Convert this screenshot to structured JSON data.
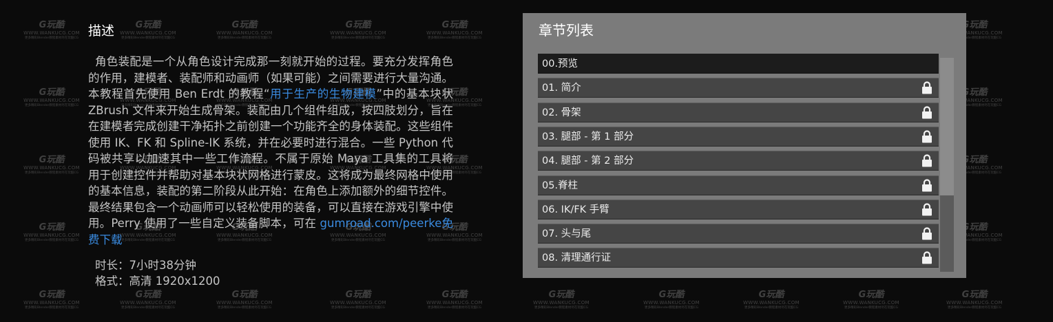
{
  "description": {
    "title": "描述",
    "body_part1": "角色装配是一个从角色设计完成那一刻就开始的过程。要充分发挥角色的作用，建模者、装配师和动画师（如果可能）之间需要进行大量沟通。本教程首先使用 Ben Erdt 的教程“",
    "body_link1": "用于生产的生物建模",
    "body_part2": "”中的基本块状 ZBrush 文件来开始生成骨架。装配由几个组件组成，按四肢划分，旨在在建模者完成创建干净拓扑之前创建一个功能齐全的身体装配。这些组件使用 IK、FK 和 Spline-IK 系统，并在必要时进行混合。一些 Python 代码被共享以加速其中一些工作流程。不属于原始 Maya 工具集的工具将用于创建控件并帮助对基本块状网格进行蒙皮。这将成为最终网格中使用的基本信息，装配的第二阶段从此开始：在角色上添加额外的细节控件。最终结果包含一个动画师可以轻松使用的装备，可以直接在游戏引擎中使用。Perry 使用了一些自定义装备脚本，可在 ",
    "body_link2": "gumroad.com/peerke免费下载",
    "duration": "时长：7小时38分钟",
    "format": "格式：高清 1920x1200",
    "link_color": "#3a8be0"
  },
  "chapters": {
    "title": "章节列表",
    "lock_icon": "lock-icon",
    "items": [
      {
        "label": "00.预览",
        "locked": false,
        "active": true
      },
      {
        "label": "01. 简介",
        "locked": true,
        "active": false
      },
      {
        "label": "02. 骨架",
        "locked": true,
        "active": false
      },
      {
        "label": "03. 腿部 - 第 1 部分",
        "locked": true,
        "active": false
      },
      {
        "label": "04. 腿部 - 第 2 部分",
        "locked": true,
        "active": false
      },
      {
        "label": "05.脊柱",
        "locked": true,
        "active": false
      },
      {
        "label": "06. IK/FK 手臂",
        "locked": true,
        "active": false
      },
      {
        "label": "07. 头与尾",
        "locked": true,
        "active": false
      },
      {
        "label": "08. 清理通行证",
        "locked": true,
        "active": false
      }
    ]
  },
  "watermark": {
    "logo": "G玩酷",
    "url": "WWW.WANKUCG.COM",
    "tagline": "更多精彩Blender教程素材尽在玩酷CG"
  }
}
